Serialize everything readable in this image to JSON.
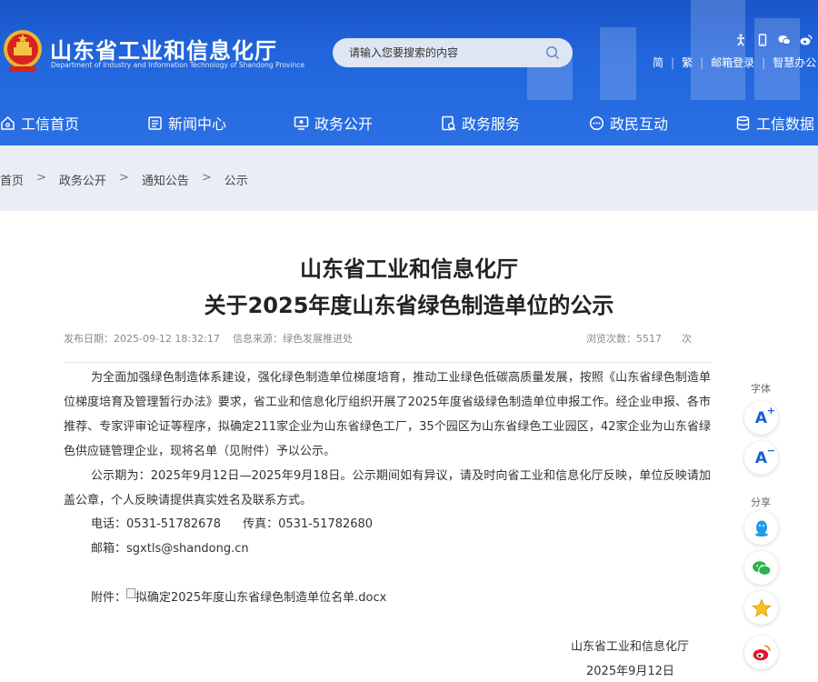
{
  "header": {
    "site_title": "山东省工业和信息化厅",
    "site_subtitle": "Department of Industry and Information Technology of Shandong Province",
    "search_placeholder": "请输入您要搜索的内容",
    "top_icons": [
      "accessibility-icon",
      "mobile-icon",
      "wechat-icon",
      "weibo-icon"
    ],
    "top_links": [
      "简",
      "繁",
      "邮箱登录",
      "智慧办公"
    ]
  },
  "nav": {
    "items": [
      {
        "label": "工信首页",
        "icon": "home-icon"
      },
      {
        "label": "新闻中心",
        "icon": "news-icon"
      },
      {
        "label": "政务公开",
        "icon": "monitor-icon"
      },
      {
        "label": "政务服务",
        "icon": "service-icon"
      },
      {
        "label": "政民互动",
        "icon": "chat-icon"
      },
      {
        "label": "工信数据",
        "icon": "database-icon"
      }
    ]
  },
  "breadcrumb": {
    "items": [
      "首页",
      "政务公开",
      "通知公告",
      "公示"
    ],
    "separator": ">"
  },
  "article": {
    "title_line1": "山东省工业和信息化厅",
    "title_line2": "关于2025年度山东省绿色制造单位的公示",
    "publish_label": "发布日期：",
    "publish_date": "2025-09-12 18:32:17",
    "source_label": "信息来源：",
    "source": "绿色发展推进处",
    "views_label": "浏览次数：",
    "views": "5517",
    "views_unit": "次",
    "para1": "为全面加强绿色制造体系建设，强化绿色制造单位梯度培育，推动工业绿色低碳高质量发展，按照《山东省绿色制造单位梯度培育及管理暂行办法》要求，省工业和信息化厅组织开展了2025年度省级绿色制造单位申报工作。经企业申报、各市推荐、专家评审论证等程序，拟确定211家企业为山东省绿色工厂，35个园区为山东省绿色工业园区，42家企业为山东省绿色供应链管理企业，现将名单（见附件）予以公示。",
    "para2": "公示期为：2025年9月12日—2025年9月18日。公示期间如有异议，请及时向省工业和信息化厅反映，单位反映请加盖公章，个人反映请提供真实姓名及联系方式。",
    "phone_label": "电话：",
    "phone": "0531-51782678",
    "fax_label": "传真：",
    "fax": "0531-51782680",
    "email_label": "邮箱：",
    "email": "sgxtls@shandong.cn",
    "attachment_label": "附件：",
    "attachment_name": "拟确定2025年度山东省绿色制造单位名单.docx",
    "signature_org": "山东省工业和信息化厅",
    "signature_date": "2025年9月12日"
  },
  "side_toolbar": {
    "font_label": "字体",
    "font_increase": "A",
    "font_increase_mark": "+",
    "font_decrease": "A",
    "font_decrease_mark": "−",
    "share_label": "分享",
    "share_icons": [
      "qq-icon",
      "wechat-share-icon",
      "qzone-icon",
      "weibo-share-icon"
    ]
  },
  "colors": {
    "header_blue": "#2266dd",
    "breadcrumb_bg": "#e9eef6",
    "accent_blue": "#1d5fcf",
    "emblem_red": "#d8231f",
    "emblem_gold": "#f4c542"
  }
}
